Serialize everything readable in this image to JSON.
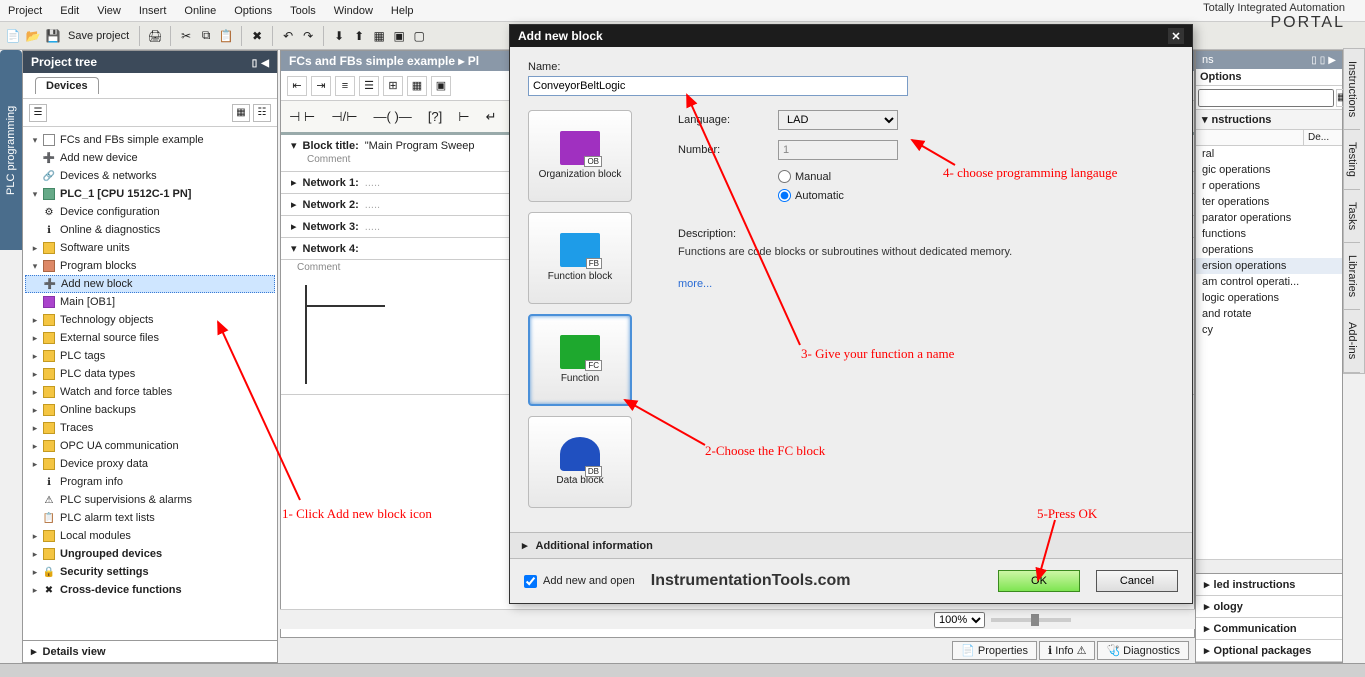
{
  "menu": [
    "Project",
    "Edit",
    "View",
    "Insert",
    "Online",
    "Options",
    "Tools",
    "Window",
    "Help"
  ],
  "brand": {
    "line": "Totally Integrated Automation",
    "portal": "PORTAL"
  },
  "toolbar": {
    "save": "Save project"
  },
  "leftTab": "PLC programming",
  "projectTree": {
    "title": "Project tree",
    "tab": "Devices",
    "root": "FCs and FBs simple example",
    "addDevice": "Add new device",
    "devNet": "Devices & networks",
    "plc": "PLC_1 [CPU 1512C-1 PN]",
    "devCfg": "Device configuration",
    "onlineDiag": "Online & diagnostics",
    "swUnits": "Software units",
    "progBlocks": "Program blocks",
    "addBlock": "Add new block",
    "mainOB": "Main [OB1]",
    "techObj": "Technology objects",
    "extSrc": "External source files",
    "plcTags": "PLC tags",
    "plcTypes": "PLC data types",
    "watch": "Watch and force tables",
    "backups": "Online backups",
    "traces": "Traces",
    "opcua": "OPC UA communication",
    "proxy": "Device proxy data",
    "progInfo": "Program info",
    "superv": "PLC supervisions & alarms",
    "alarmLists": "PLC alarm text lists",
    "localMod": "Local modules",
    "ungrouped": "Ungrouped devices",
    "security": "Security settings",
    "crossDev": "Cross-device functions",
    "details": "Details view"
  },
  "editor": {
    "breadcrumb": "FCs and FBs simple example  ▸  Pl",
    "blockTitle": "Block title:",
    "blockTitleVal": "\"Main Program Sweep",
    "comment": "Comment",
    "net1": "Network 1:",
    "net2": "Network 2:",
    "net3": "Network 3:",
    "net4": "Network 4:",
    "dots": "....."
  },
  "zoom": "100%",
  "statusTabs": {
    "props": "Properties",
    "info": "Info",
    "diag": "Diagnostics"
  },
  "rightPanel": {
    "title": "ns",
    "options": "Options",
    "instructions": "nstructions",
    "cols": {
      "de": "De..."
    },
    "items": [
      "ral",
      "gic operations",
      "r operations",
      "ter operations",
      "parator operations",
      "functions",
      " operations",
      "ersion operations",
      "am control operati...",
      "logic operations",
      "and rotate",
      "cy"
    ],
    "ext": "led instructions",
    "tech": "ology",
    "comm": "Communication",
    "optpkg": "Optional packages"
  },
  "rightTabs": [
    "Instructions",
    "Testing",
    "Tasks",
    "Libraries",
    "Add-ins"
  ],
  "dialog": {
    "title": "Add new block",
    "nameLabel": "Name:",
    "nameValue": "ConveyorBeltLogic",
    "langLabel": "Language:",
    "langValue": "LAD",
    "numLabel": "Number:",
    "numValue": "1",
    "manual": "Manual",
    "auto": "Automatic",
    "descLabel": "Description:",
    "descText": "Functions are code blocks or subroutines without dedicated memory.",
    "more": "more...",
    "addInfo": "Additional information",
    "addOpen": "Add new and open",
    "ok": "OK",
    "cancel": "Cancel",
    "watermark": "InstrumentationTools.com",
    "blocks": {
      "ob": "Organization block",
      "fb": "Function block",
      "fc": "Function",
      "db": "Data block"
    }
  },
  "annotations": {
    "a1": "1- Click Add new block icon",
    "a2": "2-Choose the FC block",
    "a3": "3- Give your function a name",
    "a4": "4- choose programming langauge",
    "a5": "5-Press OK"
  }
}
